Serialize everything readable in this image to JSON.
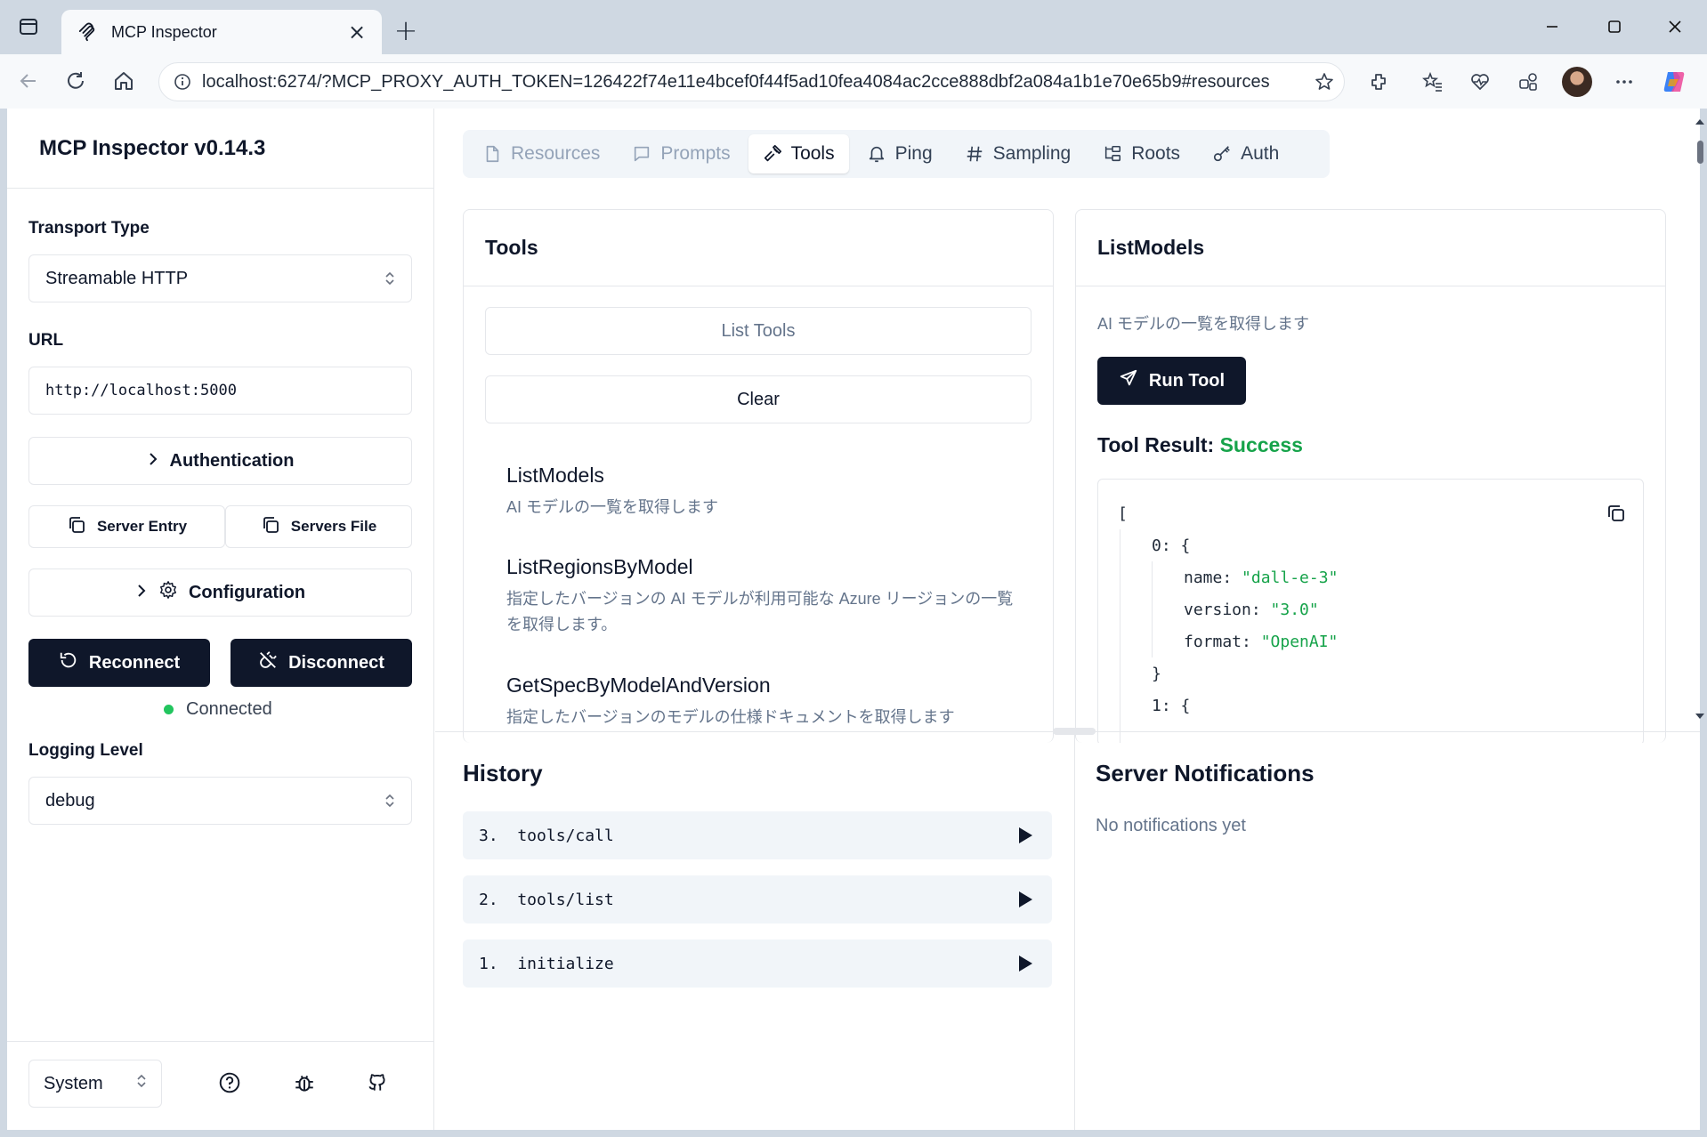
{
  "browser": {
    "tab_title": "MCP Inspector",
    "url": "localhost:6274/?MCP_PROXY_AUTH_TOKEN=126422f74e11e4bcef0f44f5ad10fea4084ac2cce888dbf2a084a1b1e70e65b9#resources"
  },
  "sidebar": {
    "title": "MCP Inspector v0.14.3",
    "transport_label": "Transport Type",
    "transport_value": "Streamable HTTP",
    "url_label": "URL",
    "url_value": "http://localhost:5000",
    "authentication_label": "Authentication",
    "server_entry_label": "Server Entry",
    "servers_file_label": "Servers File",
    "configuration_label": "Configuration",
    "reconnect_label": "Reconnect",
    "disconnect_label": "Disconnect",
    "status_text": "Connected",
    "logging_label": "Logging Level",
    "logging_value": "debug",
    "theme_value": "System"
  },
  "main_tabs": [
    {
      "label": "Resources",
      "icon": "file-icon",
      "state": "disabled"
    },
    {
      "label": "Prompts",
      "icon": "message-icon",
      "state": "disabled"
    },
    {
      "label": "Tools",
      "icon": "hammer-icon",
      "state": "active"
    },
    {
      "label": "Ping",
      "icon": "bell-icon",
      "state": "normal"
    },
    {
      "label": "Sampling",
      "icon": "hash-icon",
      "state": "normal"
    },
    {
      "label": "Roots",
      "icon": "folder-tree-icon",
      "state": "normal"
    },
    {
      "label": "Auth",
      "icon": "key-icon",
      "state": "normal"
    }
  ],
  "tools_panel": {
    "title": "Tools",
    "list_tools_label": "List Tools",
    "clear_label": "Clear",
    "tools": [
      {
        "name": "ListModels",
        "description": "AI モデルの一覧を取得します"
      },
      {
        "name": "ListRegionsByModel",
        "description": "指定したバージョンの AI モデルが利用可能な Azure リージョンの一覧を取得します。"
      },
      {
        "name": "GetSpecByModelAndVersion",
        "description": "指定したバージョンのモデルの仕様ドキュメントを取得します"
      }
    ]
  },
  "detail_panel": {
    "title": "ListModels",
    "description": "AI モデルの一覧を取得します",
    "run_label": "Run Tool",
    "result_label": "Tool Result:",
    "result_status": "Success",
    "json": {
      "open_bracket": "[",
      "item0_key": "0:",
      "open_brace": "{",
      "name_key": "name:",
      "name_value": "\"dall-e-3\"",
      "version_key": "version:",
      "version_value": "\"3.0\"",
      "format_key": "format:",
      "format_value": "\"OpenAI\"",
      "close_brace": "}",
      "item1_key": "1:",
      "open_brace2": "{"
    }
  },
  "history": {
    "title": "History",
    "items": [
      "3.  tools/call",
      "2.  tools/list",
      "1.  initialize"
    ]
  },
  "notifications": {
    "title": "Server Notifications",
    "empty_text": "No notifications yet"
  },
  "colors": {
    "primary_dark": "#0f172a",
    "success_green": "#16a34a",
    "status_dot": "#22c55e",
    "browser_frame": "#cfd8e2"
  }
}
